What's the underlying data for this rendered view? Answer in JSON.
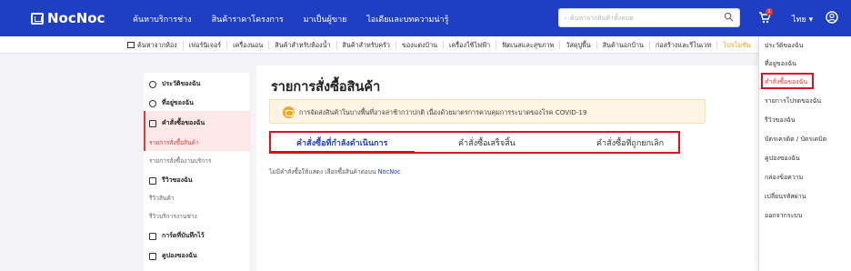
{
  "brand": {
    "logo_text": "NocNoc",
    "color_primary": "#1e3fc4",
    "color_accent": "#e53935"
  },
  "topnav": {
    "items": [
      "ค้นหาบริการช่าง",
      "สินค้าราคาโครงการ",
      "มาเป็นผู้ขาย",
      "ไอเดียและบทความน่ารู้"
    ],
    "search_placeholder": "ค้นหาจากสินค้าทั้งหมด",
    "cart_count": "1",
    "language": "ไทย ▾"
  },
  "categories": [
    "ค้นหาจากห้อง",
    "เฟอร์นิเจอร์",
    "เครื่องนอน",
    "สินค้าสำหรับห้องน้ำ",
    "สินค้าสำหรับครัว",
    "ของแต่งบ้าน",
    "เครื่องใช้ไฟฟ้า",
    "ฟิตเนสและสุขภาพ",
    "วัสดุปูพื้น",
    "สินค้านอกบ้าน",
    "ก่อสร้างและรีโนเวท",
    "โปรโมชั่น"
  ],
  "account_menu": {
    "items": [
      "ประวัติของฉัน",
      "ที่อยู่ของฉัน",
      "คำสั่งซื้อของฉัน",
      "รายการโปรดของฉัน",
      "รีวิวของฉัน",
      "บัตรเครดิต / บัตรเดบิต",
      "คูปองของฉัน",
      "กล่องข้อความ",
      "เปลี่ยนรหัสผ่าน",
      "ออกจากระบบ"
    ],
    "active_index": 2
  },
  "sidebar": {
    "profile": "ประวัติของฉัน",
    "address": "ที่อยู่ของฉัน",
    "orders": "คำสั่งซื้อของฉัน",
    "orders_products": "รายการสั่งซื้อสินค้า",
    "orders_services": "รายการสั่งซื้องานบริการ",
    "reviews": "รีวิวของฉัน",
    "reviews_products": "รีวิวสินค้า",
    "reviews_services": "รีวิวบริการงานช่าง",
    "saved_cards": "การ์ดที่บันทึกไว้",
    "coupons": "คูปองของฉัน"
  },
  "main": {
    "title": "รายการสั่งซื้อสินค้า",
    "notice": "การจัดส่งสินค้าในบางพื้นที่อาจล่าช้ากว่าปกติ เนื่องด้วยมาตรการควบคุมการระบาดของโรค COVID-19",
    "tabs": [
      "คำสั่งซื้อที่กำลังดำเนินการ",
      "คำสั่งซื้อเสร็จสิ้น",
      "คำสั่งซื้อที่ถูกยกเลิก"
    ],
    "empty_text": "ไม่มีคำสั่งซื้อให้แสดง เลือกซื้อสินค้าต่อบน",
    "empty_link": "NocNoc"
  }
}
